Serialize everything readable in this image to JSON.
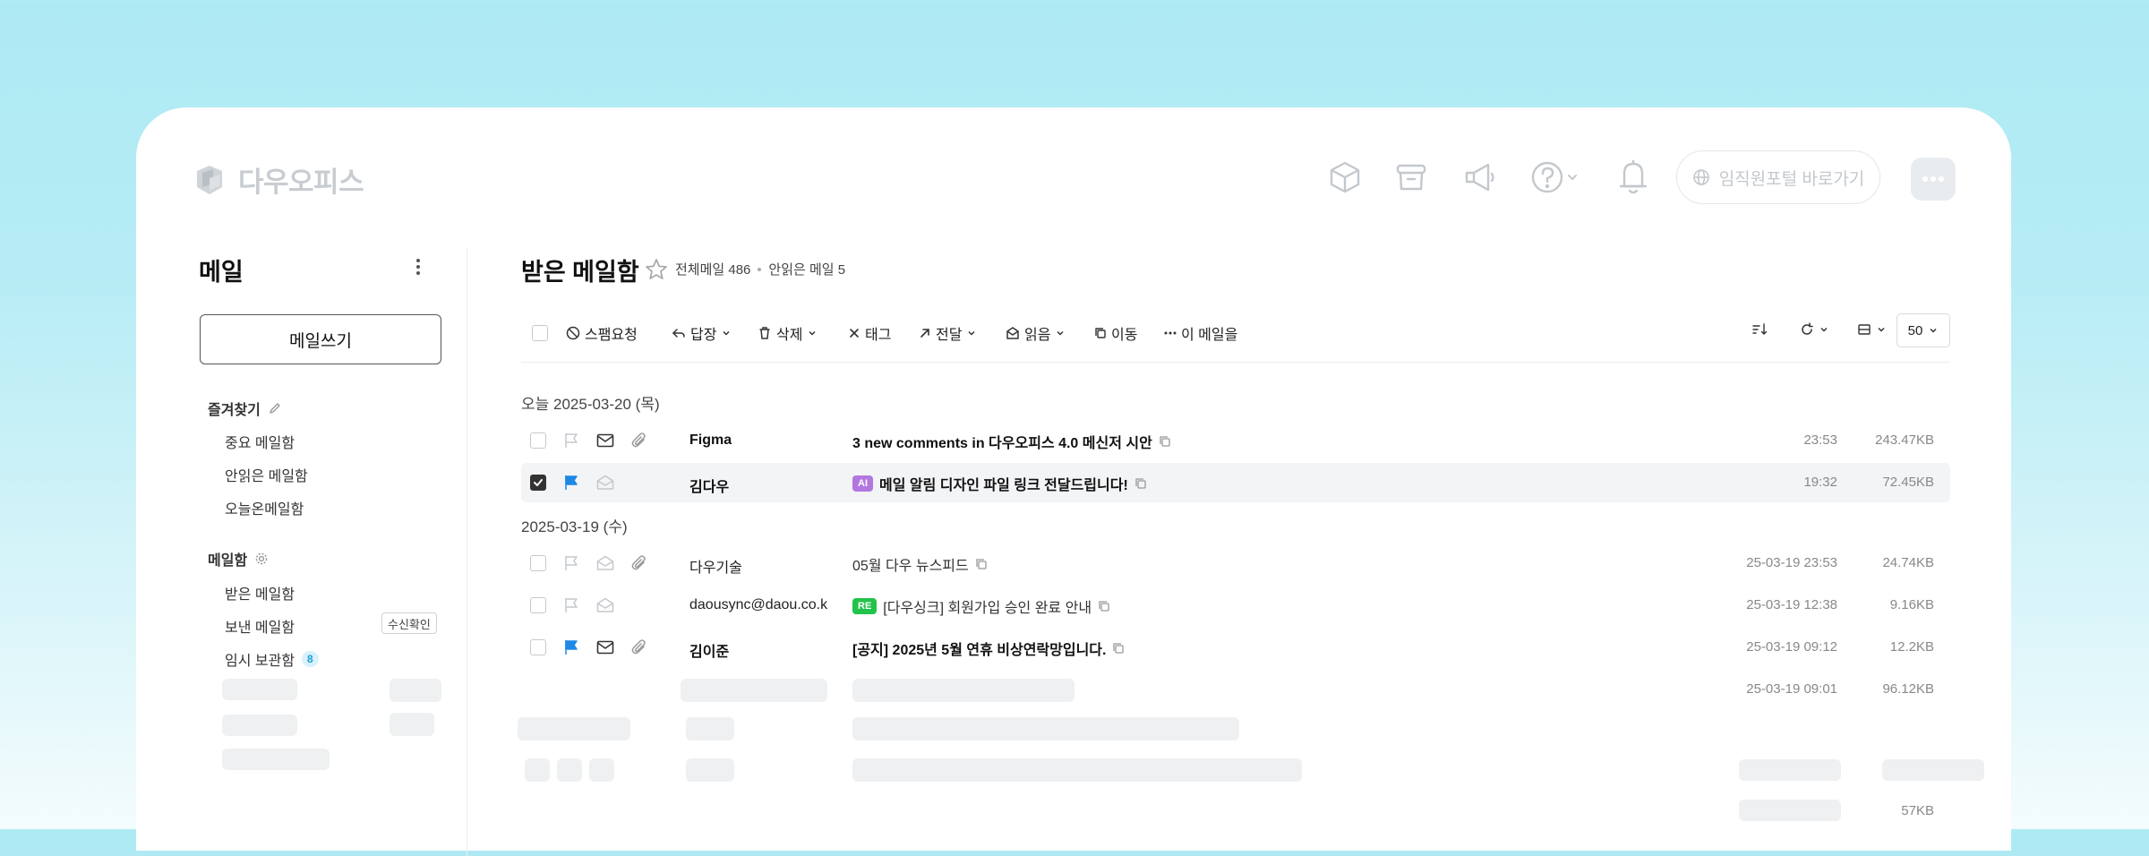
{
  "header": {
    "logo_text": "다우오피스",
    "portal_button_label": "임직원포털 바로가기",
    "icons": [
      "cube-icon",
      "archive-icon",
      "megaphone-icon",
      "help-icon",
      "bell-icon",
      "more-icon"
    ]
  },
  "sidebar": {
    "title": "메일",
    "compose_label": "메일쓰기",
    "favorites": {
      "title": "즐겨찾기",
      "items": [
        "중요 메일함",
        "안읽은 메일함",
        "오늘온메일함"
      ]
    },
    "mailboxes": {
      "title": "메일함",
      "items": [
        "받은 메일함",
        "보낸 메일함",
        "임시 보관함"
      ],
      "receipt_label": "수신확인",
      "draft_count": "8"
    }
  },
  "main": {
    "title": "받은 메일함",
    "total_label": "전체메일 486",
    "unread_label": "안읽은 메일 5",
    "toolbar": {
      "spam": "스팸요청",
      "reply": "답장",
      "delete": "삭제",
      "tag": "태그",
      "forward": "전달",
      "read": "읽음",
      "move": "이동",
      "more": "이 메일을",
      "page_size": "50"
    },
    "groups": [
      {
        "label": "오늘 2025-03-20 (목)",
        "rows": [
          {
            "sender": "Figma",
            "subject": "3 new comments in 다우오피스 4.0 메신저 시안",
            "tag": "",
            "time": "23:53",
            "size": "243.47KB"
          },
          {
            "sender": "김다우",
            "subject": "메일 알림 디자인 파일 링크 전달드립니다!",
            "tag": "AI",
            "time": "19:32",
            "size": "72.45KB"
          }
        ]
      },
      {
        "label": "2025-03-19 (수)",
        "rows": [
          {
            "sender": "다우기술",
            "subject": "05월 다우 뉴스피드",
            "tag": "",
            "time": "25-03-19 23:53",
            "size": "24.74KB"
          },
          {
            "sender": "daousync@daou.co.k",
            "subject": "[다우싱크] 회원가입 승인 완료 안내",
            "tag": "RE",
            "time": "25-03-19 12:38",
            "size": "9.16KB"
          },
          {
            "sender": "김이준",
            "subject": "[공지] 2025년 5월 연휴 비상연락망입니다.",
            "tag": "",
            "time": "25-03-19 09:12",
            "size": "12.2KB"
          }
        ]
      }
    ],
    "loading_rows": [
      {
        "time": "25-03-19 09:01",
        "size": "96.12KB"
      },
      {
        "size": "57KB"
      }
    ]
  },
  "colors": {
    "accent_blue": "#1e88e5",
    "ai_tag": "#b377e0",
    "re_tag": "#22c34a",
    "skeleton": "#eef0f2"
  }
}
